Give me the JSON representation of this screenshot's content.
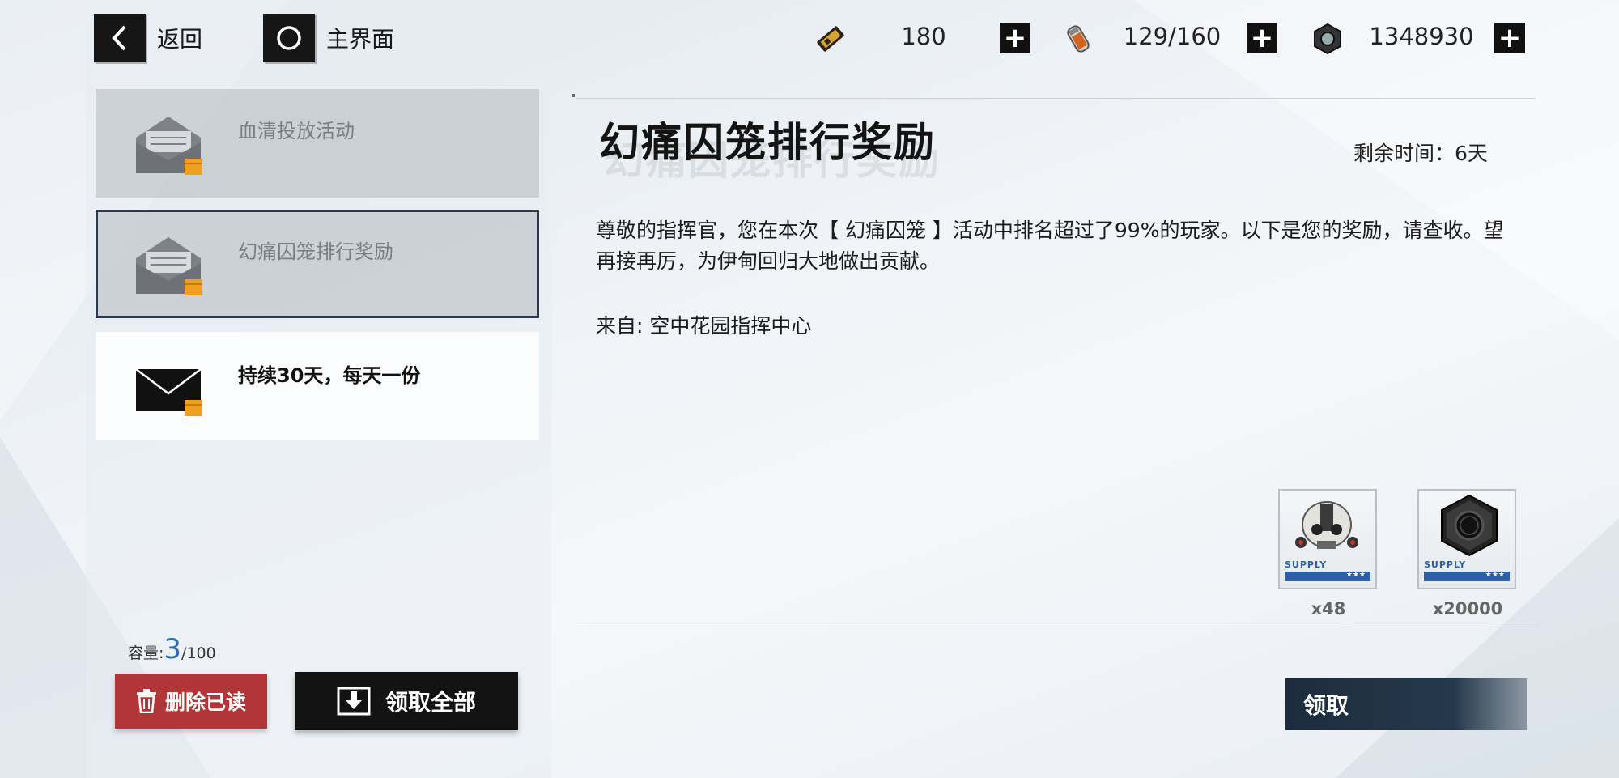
{
  "nav": {
    "back_label": "返回",
    "home_label": "主界面"
  },
  "resources": [
    {
      "icon": "ticket-icon",
      "value": "180"
    },
    {
      "icon": "serum-icon",
      "value": "129/160"
    },
    {
      "icon": "hex-nut-icon",
      "value": "1348930"
    }
  ],
  "mail_list": [
    {
      "title": "血清投放活动",
      "state": "read"
    },
    {
      "title": "幻痛囚笼排行奖励",
      "state": "read-selected"
    },
    {
      "title": "持续30天，每天一份",
      "state": "unread"
    }
  ],
  "capacity": {
    "label": "容量:",
    "used": "3",
    "total": "/100"
  },
  "buttons": {
    "delete_read": "删除已读",
    "collect_all": "领取全部",
    "claim": "领取"
  },
  "detail": {
    "title": "幻痛囚笼排行奖励",
    "remaining_time": "剩余时间：6天",
    "body": "尊敬的指挥官，您在本次【 幻痛囚笼 】活动中排名超过了99%的玩家。以下是您的奖励，请查收。望再接再厉，为伊甸回归大地做出贡献。",
    "sender": "来自: 空中花园指挥中心",
    "rewards": [
      {
        "icon": "mech-skull-icon",
        "tag": "SUPPLY",
        "stars": "★★★",
        "quantity": "x48"
      },
      {
        "icon": "hex-nut-icon",
        "tag": "SUPPLY",
        "stars": "★★★",
        "quantity": "x20000"
      }
    ]
  },
  "colors": {
    "delete_red": "#b23537",
    "capacity_blue": "#2f6db5",
    "claim_navy": "#1c2c3d"
  }
}
